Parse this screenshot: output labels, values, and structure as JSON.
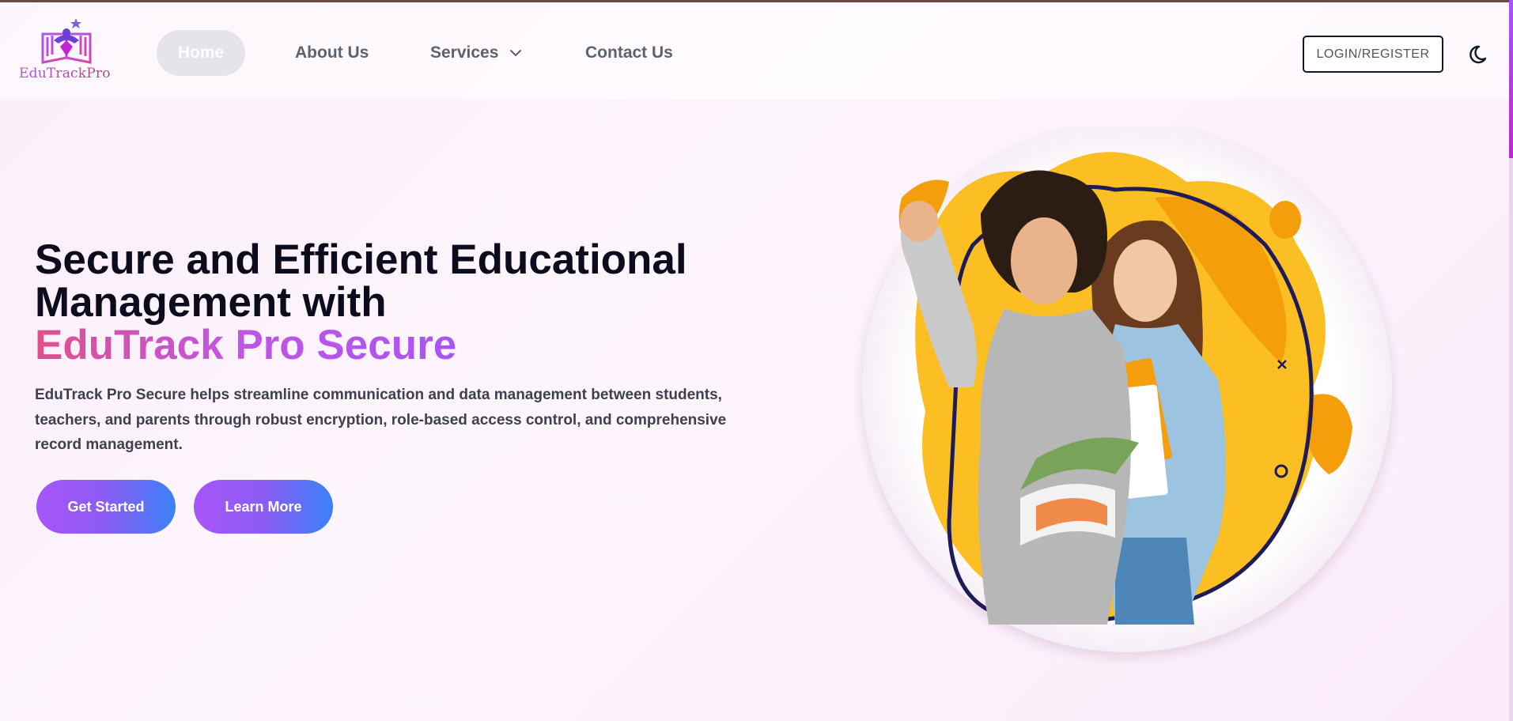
{
  "brand": {
    "logo_text": "EduTrackPro",
    "colors": {
      "purple": "#a855f7",
      "rose": "#be3f6f",
      "blue": "#3b82f6"
    }
  },
  "nav": {
    "items": [
      {
        "label": "Home",
        "active": true
      },
      {
        "label": "About Us"
      },
      {
        "label": "Services",
        "icon": "chevron-down-icon"
      },
      {
        "label": "Contact Us"
      }
    ],
    "login_label": "LOGIN/REGISTER",
    "theme_toggle_icon": "moon-icon"
  },
  "hero": {
    "title_line1": "Secure and Efficient Educational",
    "title_line2": "Management with",
    "title_accent": "EduTrack Pro Secure",
    "description": "EduTrack Pro Secure helps streamline communication and data management between students, teachers, and parents through robust encryption, role-based access control, and comprehensive record management.",
    "primary_button": "Get Started",
    "secondary_button": "Learn More",
    "image": "students-illustration"
  }
}
